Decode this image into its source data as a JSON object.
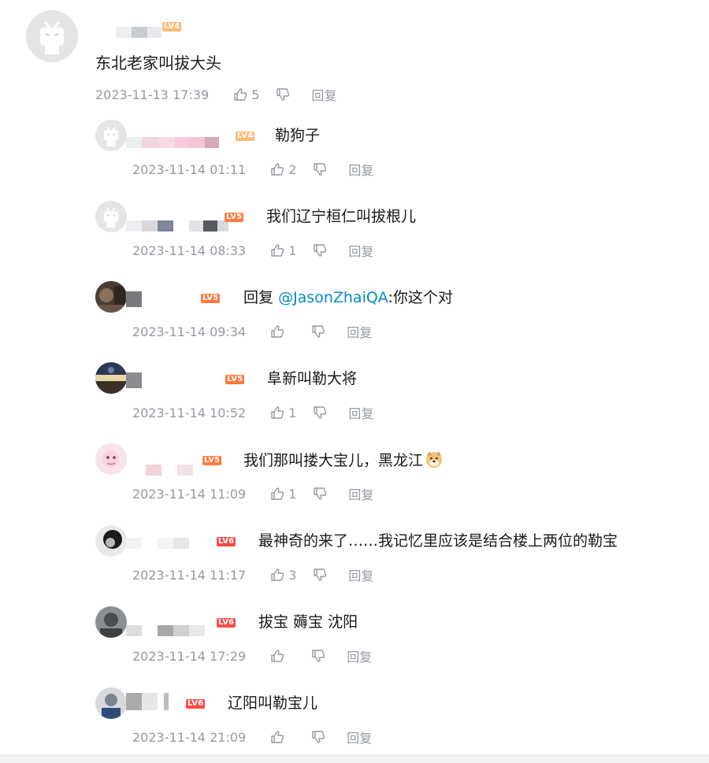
{
  "main_comment": {
    "level": "LV4",
    "content": "东北老家叫拔大头",
    "time": "2023-11-13 17:39",
    "likes": "5",
    "reply_label": "回复"
  },
  "replies": [
    {
      "level": "LV4",
      "content": "勒狗子",
      "time": "2023-11-14 01:11",
      "likes": "2",
      "reply_label": "回复"
    },
    {
      "level": "LV5",
      "content": "我们辽宁桓仁叫拔根儿",
      "time": "2023-11-14 08:33",
      "likes": "1",
      "reply_label": "回复"
    },
    {
      "level": "LV5",
      "prefix": "回复",
      "mention": "@JasonZhaiQA",
      "content": ":你这个对",
      "time": "2023-11-14 09:34",
      "likes": "",
      "reply_label": "回复"
    },
    {
      "level": "LV5",
      "content": "阜新叫勒大将",
      "time": "2023-11-14 10:52",
      "likes": "1",
      "reply_label": "回复"
    },
    {
      "level": "LV5",
      "content": "我们那叫搂大宝儿，黑龙江",
      "time": "2023-11-14 11:09",
      "likes": "1",
      "reply_label": "回复"
    },
    {
      "level": "LV6",
      "content": "最神奇的来了……我记忆里应该是结合楼上两位的勒宝",
      "time": "2023-11-14 11:17",
      "likes": "3",
      "reply_label": "回复"
    },
    {
      "level": "LV6",
      "content": "拔宝 薅宝 沈阳",
      "time": "2023-11-14 17:29",
      "likes": "",
      "reply_label": "回复"
    },
    {
      "level": "LV6",
      "content": "辽阳叫勒宝儿",
      "time": "2023-11-14 21:09",
      "likes": "",
      "reply_label": "回复"
    }
  ],
  "icons": {
    "like": "thumbs-up-icon",
    "dislike": "thumbs-down-icon",
    "default_avatar": "bilibili-tv-icon",
    "emoji": "doge-emoji"
  },
  "colors": {
    "mention": "#008ac5",
    "meta": "#9499a0",
    "lv4": "#fdba74",
    "lv5": "#ff7a3d",
    "lv6": "#ff4a4a"
  }
}
